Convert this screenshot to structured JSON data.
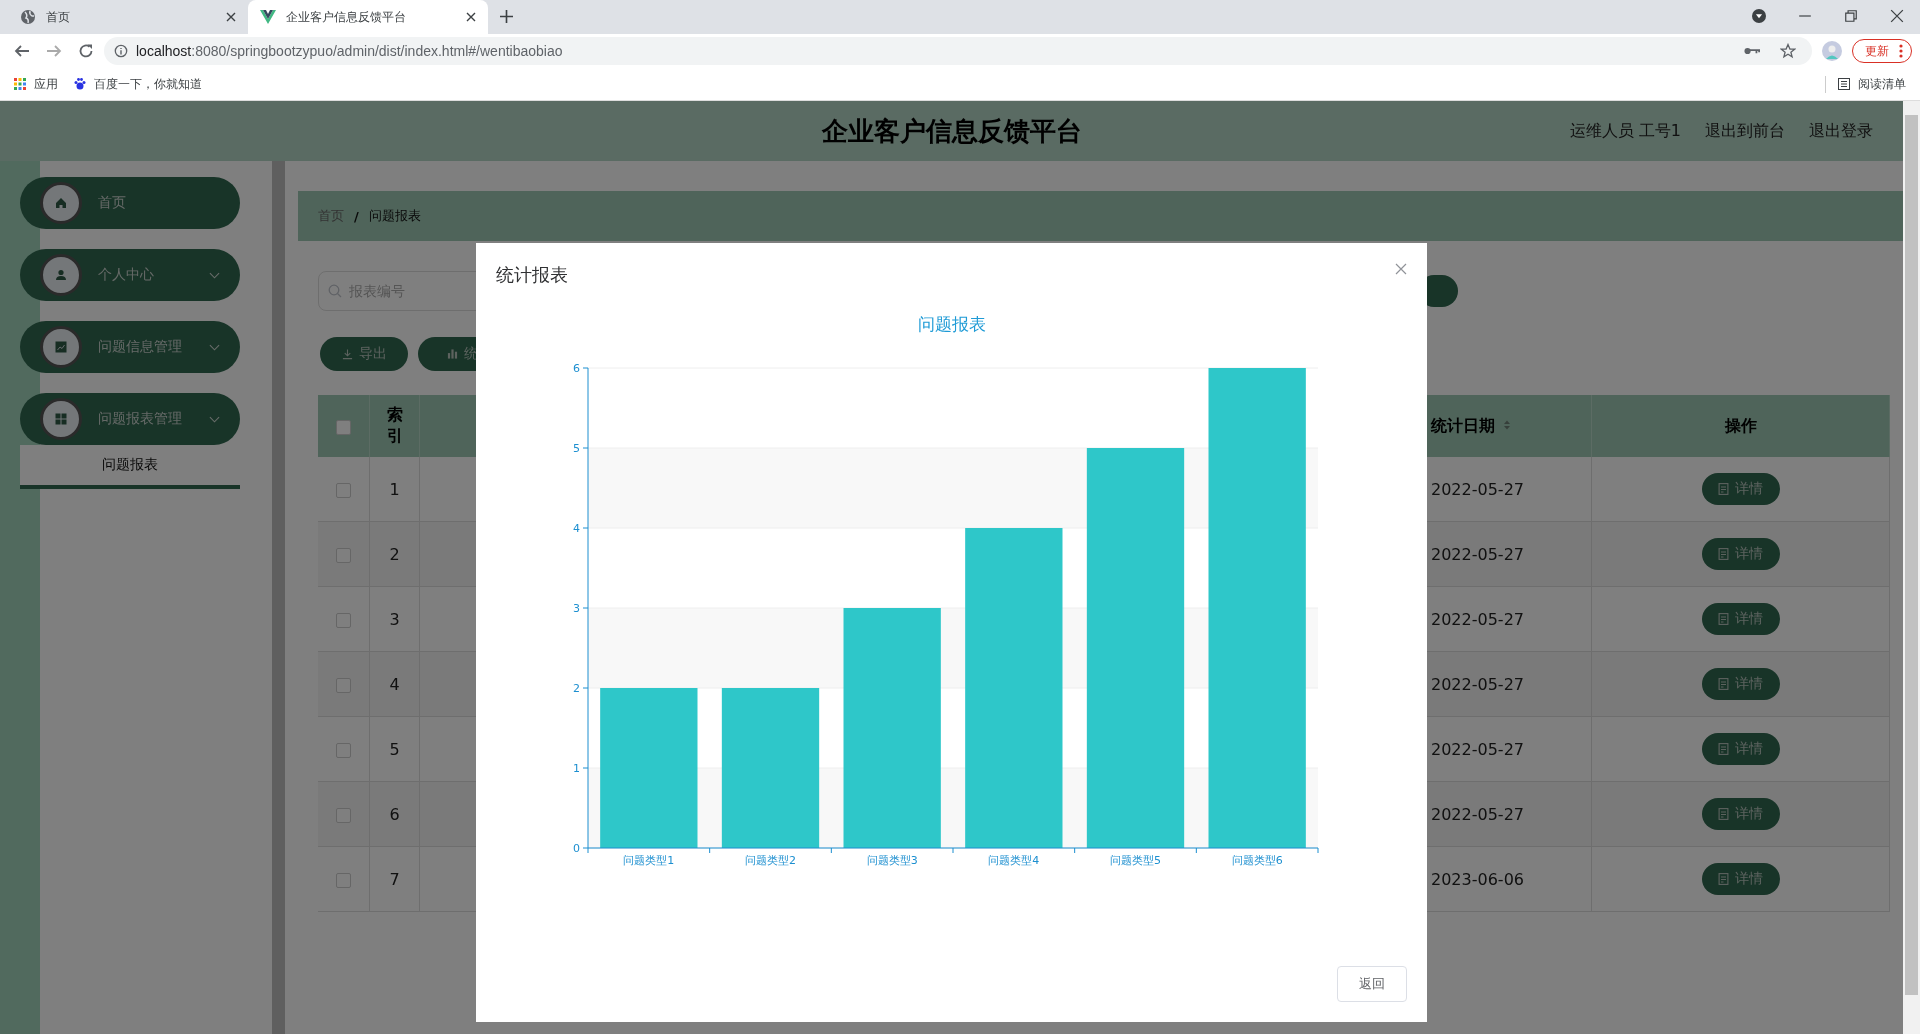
{
  "browser": {
    "tabs": [
      {
        "title": "首页",
        "selected": false
      },
      {
        "title": "企业客户信息反馈平台",
        "selected": true
      }
    ],
    "address": {
      "host": "localhost",
      "rest": ":8080/springbootzypuo/admin/dist/index.html#/wentibaobiao"
    },
    "update_button": "更新",
    "bookmarks": [
      "应用",
      "百度一下，你就知道"
    ],
    "reading_list": "阅读清单"
  },
  "header": {
    "title": "企业客户信息反馈平台",
    "user": "运维人员 工号1",
    "links": [
      "退出到前台",
      "退出登录"
    ]
  },
  "sidebar": {
    "items": [
      {
        "kind": "link",
        "label": "首页"
      },
      {
        "kind": "submenu",
        "label": "个人中心"
      },
      {
        "kind": "submenu",
        "label": "问题信息管理"
      },
      {
        "kind": "submenu",
        "label": "问题报表管理",
        "children": [
          {
            "label": "问题报表",
            "selected": true
          }
        ]
      }
    ]
  },
  "breadcrumb": [
    "首页",
    "问题报表"
  ],
  "breadcrumb_separator": "/",
  "search": {
    "placeholder": "报表编号"
  },
  "toolbar": [
    "导出",
    "统"
  ],
  "table": {
    "select_all": false,
    "columns": [
      {
        "label": "索引",
        "sortable": false
      },
      {
        "label": "统计日期",
        "sortable": true
      },
      {
        "label": "操作",
        "sortable": false
      }
    ],
    "rows": [
      {
        "index": "1",
        "date": "2022-05-27",
        "checked": false,
        "action": "详情"
      },
      {
        "index": "2",
        "date": "2022-05-27",
        "checked": false,
        "action": "详情"
      },
      {
        "index": "3",
        "date": "2022-05-27",
        "checked": false,
        "action": "详情"
      },
      {
        "index": "4",
        "date": "2022-05-27",
        "checked": false,
        "action": "详情"
      },
      {
        "index": "5",
        "date": "2022-05-27",
        "checked": false,
        "action": "详情"
      },
      {
        "index": "6",
        "date": "2022-05-27",
        "checked": false,
        "action": "详情"
      },
      {
        "index": "7",
        "date": "2023-06-06",
        "checked": false,
        "action": "详情"
      }
    ]
  },
  "modal": {
    "title": "统计报表",
    "footer_button": "返回",
    "chart_data": {
      "type": "bar",
      "title": "问题报表",
      "categories": [
        "问题类型1",
        "问题类型2",
        "问题类型3",
        "问题类型4",
        "问题类型5",
        "问题类型6"
      ],
      "values": [
        2,
        2,
        3,
        4,
        5,
        6
      ],
      "ylim": [
        0,
        6
      ],
      "yticks": [
        0,
        1,
        2,
        3,
        4,
        5,
        6
      ],
      "grid": true
    }
  }
}
